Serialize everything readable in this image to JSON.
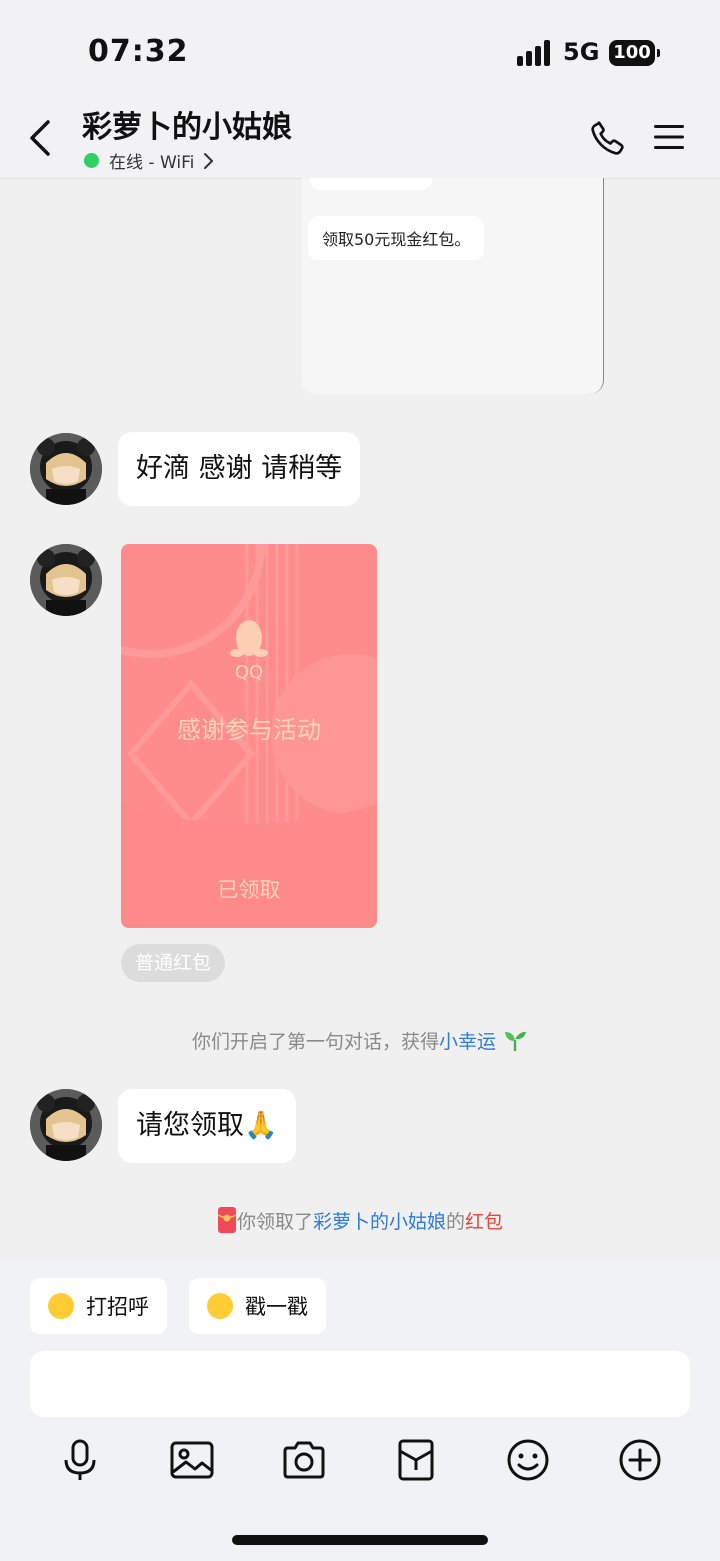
{
  "status": {
    "time": "07:32",
    "network": "5G",
    "battery": "100"
  },
  "header": {
    "title": "彩萝卜的小姑娘",
    "presence": "在线 - WiFi"
  },
  "forwarded": {
    "text": "领取50元现金红包。"
  },
  "messages": [
    {
      "text": "好滴 感谢 请稍等"
    },
    {
      "text": "请您领取🙏"
    }
  ],
  "red_packet": {
    "brand": "QQ",
    "greeting": "感谢参与活动",
    "status": "已领取",
    "type_tag": "普通红包"
  },
  "system": {
    "first_chat_prefix": "你们开启了第一句对话，获得",
    "first_chat_link": "小幸运",
    "claim_prefix": "你领取了",
    "claim_user": "彩萝卜的小姑娘",
    "claim_mid": "的",
    "claim_item": "红包"
  },
  "quick_actions": [
    {
      "label": "打招呼"
    },
    {
      "label": "戳一戳"
    }
  ],
  "toolbar_icons": [
    "mic-icon",
    "image-icon",
    "camera-icon",
    "red-packet-icon",
    "emoji-icon",
    "plus-icon"
  ],
  "colors": {
    "online": "#2ecf63",
    "link": "#2f7bd9",
    "red_packet": "#ff8e8e",
    "red_text": "#e5453d"
  }
}
